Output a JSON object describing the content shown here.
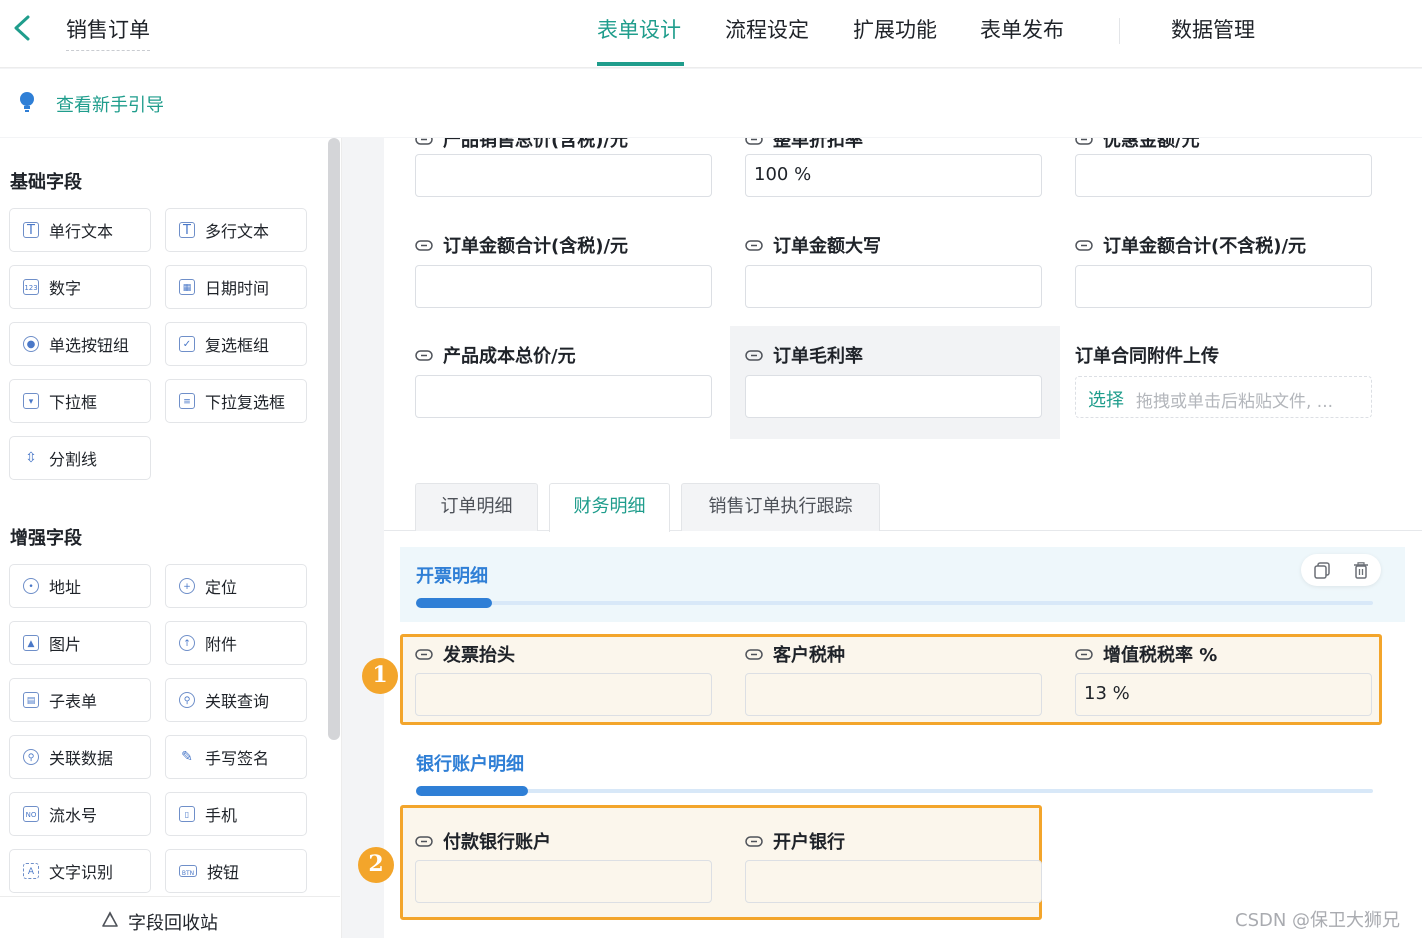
{
  "header": {
    "title": "销售订单",
    "tabs": [
      "表单设计",
      "流程设定",
      "扩展功能",
      "表单发布",
      "数据管理"
    ],
    "active_tab": "表单设计"
  },
  "guide": {
    "label": "查看新手引导"
  },
  "sidebar": {
    "basic_title": "基础字段",
    "basic_fields": [
      {
        "label": "单行文本",
        "icon": "single-line-text-icon"
      },
      {
        "label": "多行文本",
        "icon": "multi-line-text-icon"
      },
      {
        "label": "数字",
        "icon": "number-icon"
      },
      {
        "label": "日期时间",
        "icon": "calendar-icon"
      },
      {
        "label": "单选按钮组",
        "icon": "radio-icon"
      },
      {
        "label": "复选框组",
        "icon": "checkbox-icon"
      },
      {
        "label": "下拉框",
        "icon": "dropdown-icon"
      },
      {
        "label": "下拉复选框",
        "icon": "multi-dropdown-icon"
      },
      {
        "label": "分割线",
        "icon": "divider-icon"
      }
    ],
    "advanced_title": "增强字段",
    "advanced_fields": [
      {
        "label": "地址",
        "icon": "location-pin-icon"
      },
      {
        "label": "定位",
        "icon": "crosshair-icon"
      },
      {
        "label": "图片",
        "icon": "image-icon"
      },
      {
        "label": "附件",
        "icon": "attachment-icon"
      },
      {
        "label": "子表单",
        "icon": "subform-icon"
      },
      {
        "label": "关联查询",
        "icon": "link-query-icon"
      },
      {
        "label": "关联数据",
        "icon": "link-data-icon"
      },
      {
        "label": "手写签名",
        "icon": "pen-icon"
      },
      {
        "label": "流水号",
        "icon": "serial-number-icon"
      },
      {
        "label": "手机",
        "icon": "phone-icon"
      },
      {
        "label": "文字识别",
        "icon": "ocr-icon"
      },
      {
        "label": "按钮",
        "icon": "button-icon"
      }
    ],
    "recycle_label": "字段回收站"
  },
  "form": {
    "top_partial_labels": [
      "产品销售总价(含税)/元",
      "整单折扣率",
      "优惠金额/元"
    ],
    "discount_value": "100 %",
    "row2_labels": [
      "订单金额合计(含税)/元",
      "订单金额大写",
      "订单金额合计(不含税)/元"
    ],
    "row3_labels": [
      "产品成本总价/元",
      "订单毛利率",
      "订单合同附件上传"
    ],
    "upload_select": "选择",
    "upload_hint": "拖拽或单击后粘贴文件, ...",
    "tabs": [
      "订单明细",
      "财务明细",
      "销售订单执行跟踪"
    ],
    "active_tab": "财务明细",
    "invoice_section_title": "开票明细",
    "invoice_labels": [
      "发票抬头",
      "客户税种",
      "增值税税率 %"
    ],
    "vat_value": "13 %",
    "bank_section_title": "银行账户明细",
    "bank_labels": [
      "付款银行账户",
      "开户银行"
    ],
    "badge_1": "1",
    "badge_2": "2"
  },
  "colors": {
    "accent": "#1f9d8c",
    "section_blue": "#2f7fd6",
    "highlight_orange": "#f3a52b"
  },
  "watermark": "CSDN @保卫大狮兄"
}
